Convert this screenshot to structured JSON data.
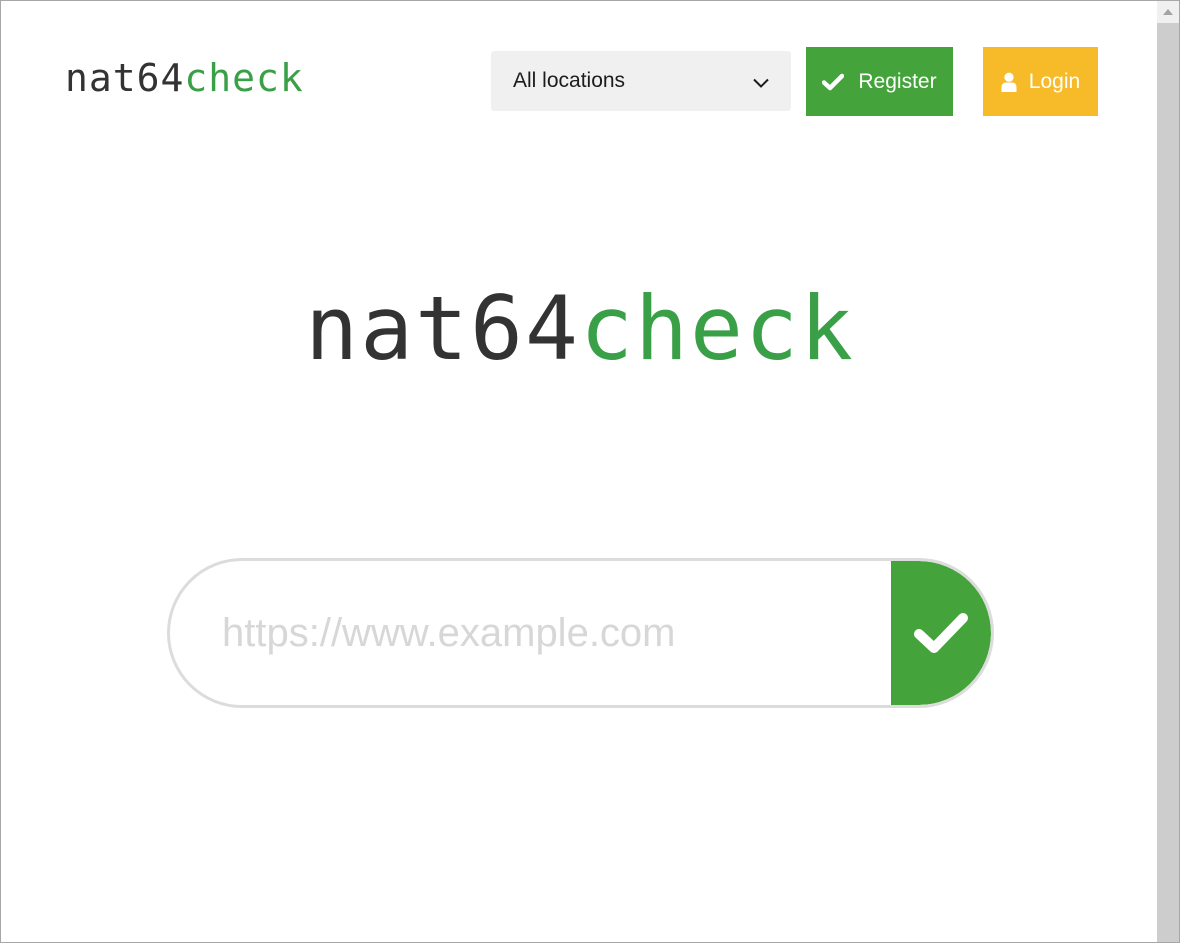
{
  "header": {
    "logo_part1": "nat64",
    "logo_part2": "check",
    "location_select": {
      "selected": "All locations",
      "icon": "chevron-down-icon"
    },
    "register_button": {
      "label": "Register",
      "icon": "check-icon",
      "color": "#44a33a"
    },
    "login_button": {
      "label": "Login",
      "icon": "user-icon",
      "color": "#f7bb2a"
    }
  },
  "main": {
    "logo_part1": "nat64",
    "logo_part2": "check",
    "url_input": {
      "value": "",
      "placeholder": "https://www.example.com"
    },
    "submit_button": {
      "icon": "check-icon",
      "color": "#44a33a"
    }
  },
  "colors": {
    "logo_dark": "#333333",
    "logo_green": "#3aa047"
  }
}
